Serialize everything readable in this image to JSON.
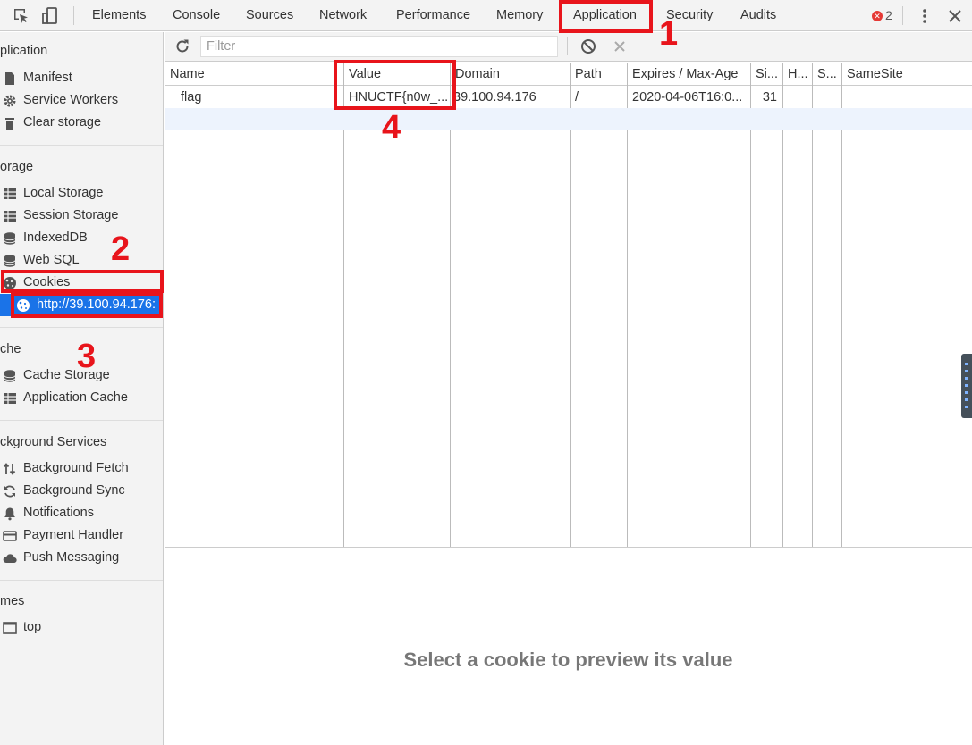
{
  "toolbar": {
    "tabs": [
      "Elements",
      "Console",
      "Sources",
      "Network",
      "Performance",
      "Memory",
      "Application",
      "Security",
      "Audits"
    ],
    "error_count": "2"
  },
  "sidebar": {
    "sections": {
      "application": {
        "title": "plication",
        "items": [
          "Manifest",
          "Service Workers",
          "Clear storage"
        ]
      },
      "storage": {
        "title": "orage",
        "items": [
          "Local Storage",
          "Session Storage",
          "IndexedDB",
          "Web SQL",
          "Cookies"
        ]
      },
      "cookie_origin": "http://39.100.94.176:",
      "cache": {
        "title": "che",
        "items": [
          "Cache Storage",
          "Application Cache"
        ]
      },
      "background_services": {
        "title": "ckground Services",
        "items": [
          "Background Fetch",
          "Background Sync",
          "Notifications",
          "Payment Handler",
          "Push Messaging"
        ]
      },
      "frames": {
        "title": "mes",
        "items": [
          "top"
        ]
      }
    }
  },
  "filter": {
    "placeholder": "Filter"
  },
  "table": {
    "columns": [
      "Name",
      "Value",
      "Domain",
      "Path",
      "Expires / Max-Age",
      "Si...",
      "H...",
      "S...",
      "SameSite"
    ],
    "rows": [
      {
        "name": "flag",
        "value": "HNUCTF{n0w_...",
        "domain": "39.100.94.176",
        "path": "/",
        "expires": "2020-04-06T16:0...",
        "size": "31",
        "httponly": "",
        "secure": "",
        "samesite": ""
      }
    ]
  },
  "preview": {
    "message": "Select a cookie to preview its value"
  },
  "annotations": {
    "n1": "1",
    "n2": "2",
    "n3": "3",
    "n4": "4"
  },
  "colors": {
    "accent": "#1a73e8",
    "annotation_red": "#e8141b",
    "row_stripe": "#edf3fd"
  }
}
